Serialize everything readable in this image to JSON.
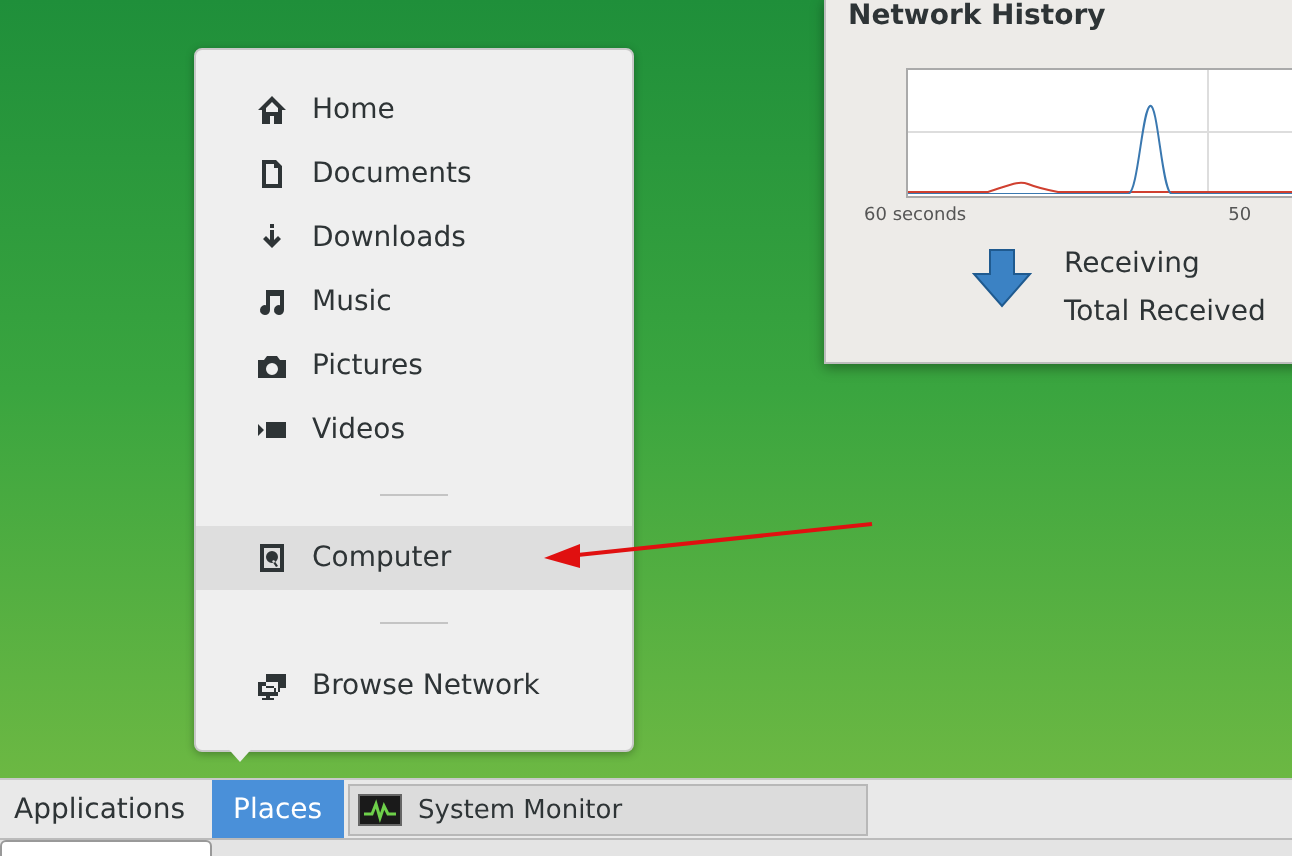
{
  "places_menu": {
    "items": [
      {
        "kind": "place",
        "label": "Home",
        "selected": false
      },
      {
        "kind": "place",
        "label": "Documents",
        "selected": false
      },
      {
        "kind": "place",
        "label": "Downloads",
        "selected": false
      },
      {
        "kind": "place",
        "label": "Music",
        "selected": false
      },
      {
        "kind": "place",
        "label": "Pictures",
        "selected": false
      },
      {
        "kind": "place",
        "label": "Videos",
        "selected": false
      },
      {
        "kind": "separator"
      },
      {
        "kind": "place",
        "label": "Computer",
        "selected": true
      },
      {
        "kind": "separator"
      },
      {
        "kind": "place",
        "label": "Browse Network",
        "selected": false
      }
    ]
  },
  "network_window": {
    "title": "Network History",
    "x_labels": [
      "60 seconds",
      "50"
    ],
    "legend": [
      "Receiving",
      "Total Received"
    ]
  },
  "taskbar": {
    "menus": [
      {
        "label": "Applications",
        "selected": false
      },
      {
        "label": "Places",
        "selected": true
      }
    ],
    "windows": [
      {
        "label": "System Monitor"
      }
    ]
  }
}
